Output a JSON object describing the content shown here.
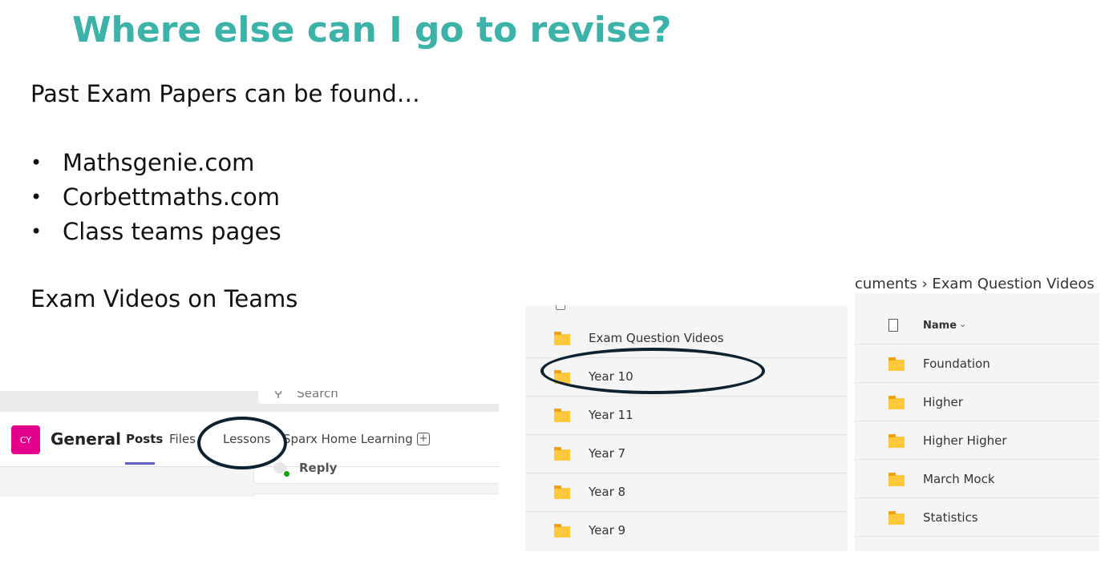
{
  "slide": {
    "title": "Where else can I go to revise?",
    "intro": "Past Exam Papers can be found…",
    "bullets": [
      "Mathsgenie.com",
      "Corbettmaths.com",
      "Class teams pages"
    ],
    "bullet_glyph": "•",
    "videos_label": "Exam Videos on Teams",
    "colors": {
      "title": "#3bb3a8",
      "ring": "#0d2230"
    }
  },
  "teams": {
    "search_placeholder": "Search",
    "avatar_initials": "CY",
    "channel": "General",
    "tabs": [
      "Posts",
      "Files",
      "Lessons",
      "Sparx Home Learning"
    ],
    "active_tab": "Posts",
    "reply_label": "Reply",
    "colors": {
      "avatar": "#e3008c",
      "active_underline": "#5b5fc7"
    }
  },
  "folder_list_left": {
    "items": [
      "Exam Question Videos",
      "Year 10",
      "Year 11",
      "Year 7",
      "Year 8",
      "Year 9"
    ]
  },
  "folder_list_right": {
    "breadcrumb": "cuments  ›  Exam Question Videos",
    "column_header": "Name",
    "items": [
      "Foundation",
      "Higher",
      "Higher Higher",
      "March Mock",
      "Statistics"
    ]
  }
}
